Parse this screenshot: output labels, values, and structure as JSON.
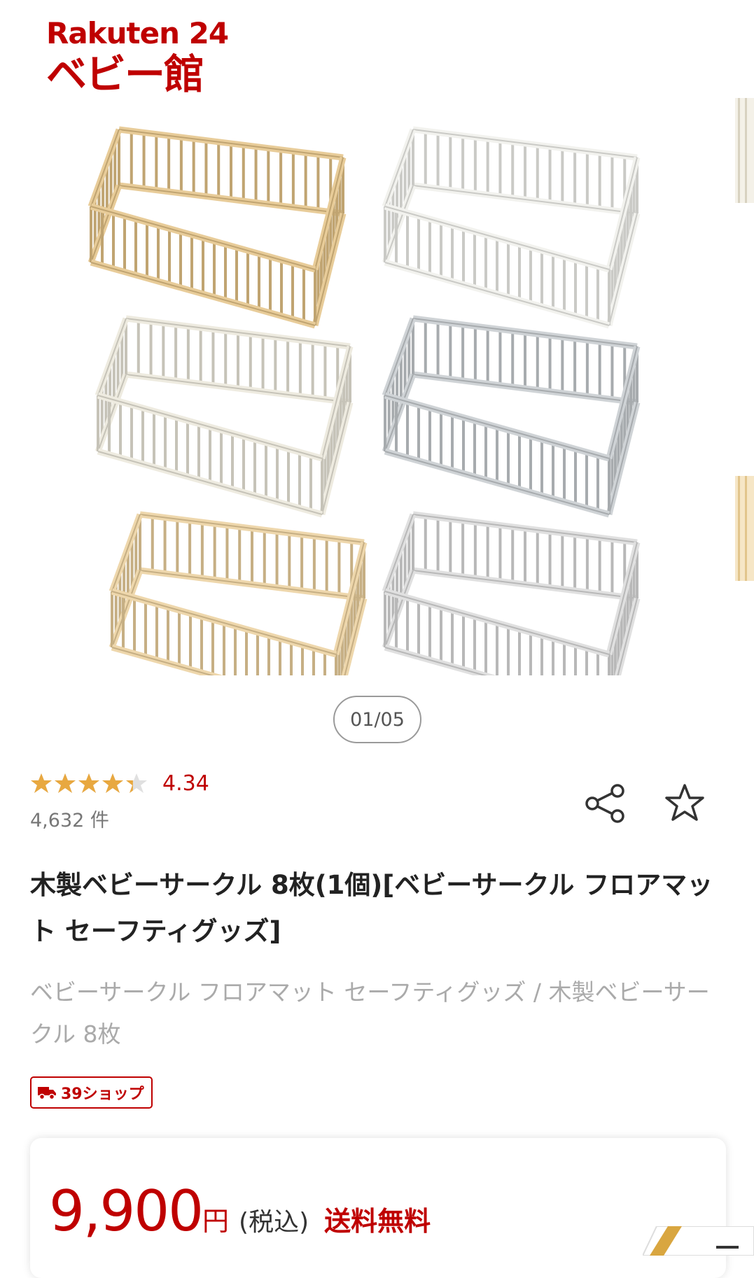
{
  "logo": {
    "line1": "Rakuten 24",
    "line2": "ベビー館"
  },
  "gallery": {
    "pager": "01/05",
    "pens": [
      {
        "color_name": "natural",
        "color": "#e8cc99"
      },
      {
        "color_name": "white",
        "color": "#f2f2ee"
      },
      {
        "color_name": "ivory",
        "color": "#eeebe0"
      },
      {
        "color_name": "gray",
        "color": "#cfd3d6"
      },
      {
        "color_name": "natural-light",
        "color": "#eed7ac"
      },
      {
        "color_name": "white-gray",
        "color": "#e0e0e0"
      }
    ]
  },
  "rating": {
    "value": "4.34",
    "count": "4,632 件",
    "stars_filled": 4.34
  },
  "actions": {
    "share_icon": "share-icon",
    "favorite_icon": "star-outline-icon"
  },
  "product": {
    "title": "木製ベビーサークル 8枚(1個)[ベビーサークル フロアマット セーフティグッズ]",
    "breadcrumb": "ベビーサークル フロアマット セーフティグッズ / 木製ベビーサークル 8枚",
    "badge": "39ショップ"
  },
  "price": {
    "amount": "9,900",
    "yen": "円",
    "tax": "(税込)",
    "shipping": "送料無料"
  },
  "colors": {
    "accent": "#bf0000",
    "star": "#e8a840"
  }
}
